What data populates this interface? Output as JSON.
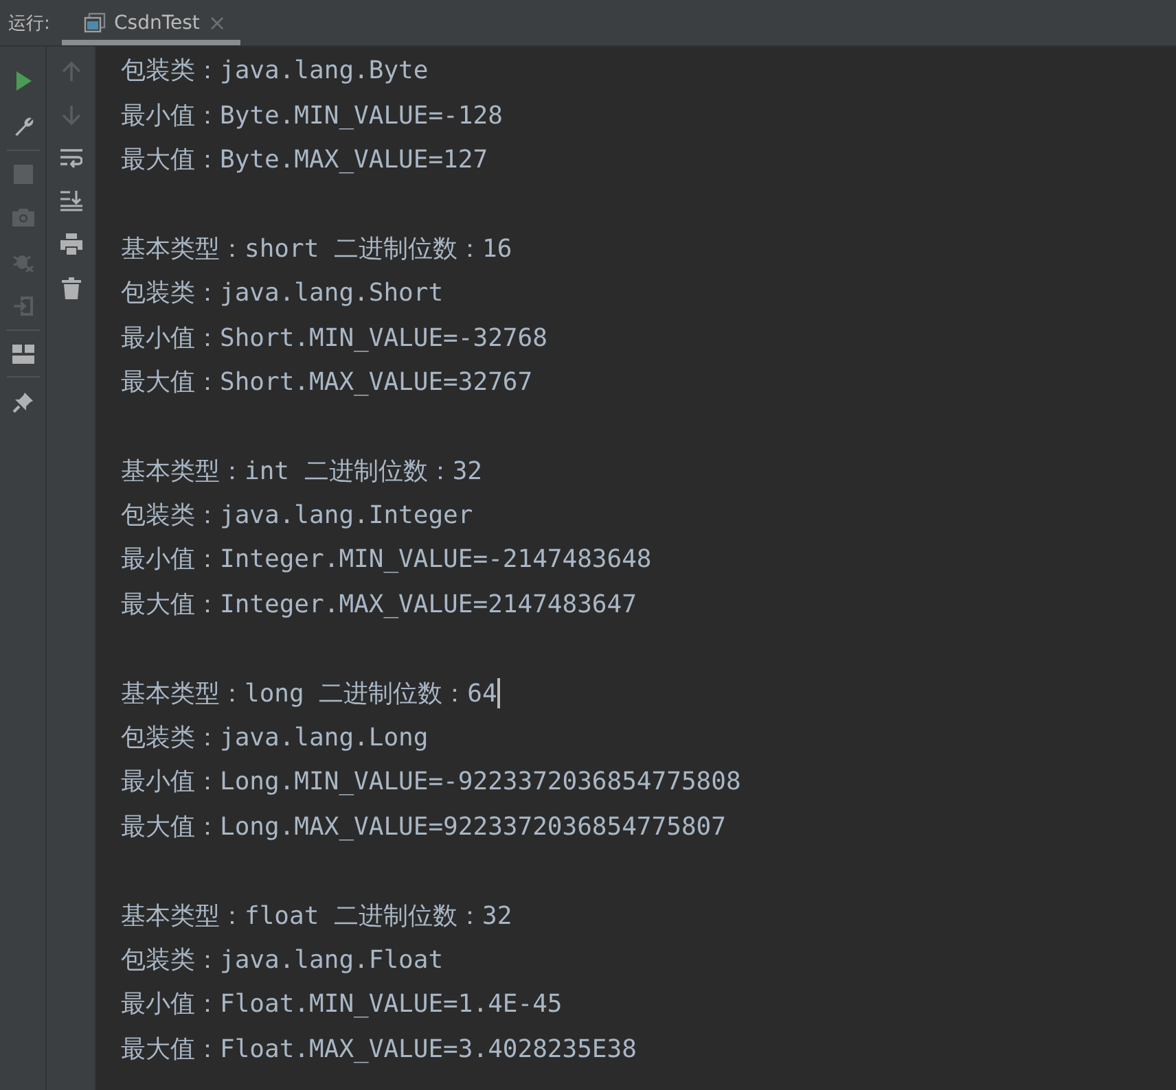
{
  "run_label": "运行:",
  "tabs": [
    {
      "label": "CsdnTest",
      "close": "×",
      "selected": true
    }
  ],
  "console": [
    [
      {
        "text": "包装类：java.lang.Byte",
        "cursor": false
      },
      {
        "text": "最小值：Byte.MIN_VALUE=-128",
        "cursor": false
      },
      {
        "text": "最大值：Byte.MAX_VALUE=127",
        "cursor": false
      }
    ],
    [
      {
        "text": "基本类型：short 二进制位数：16",
        "cursor": false
      },
      {
        "text": "包装类：java.lang.Short",
        "cursor": false
      },
      {
        "text": "最小值：Short.MIN_VALUE=-32768",
        "cursor": false
      },
      {
        "text": "最大值：Short.MAX_VALUE=32767",
        "cursor": false
      }
    ],
    [
      {
        "text": "基本类型：int 二进制位数：32",
        "cursor": false
      },
      {
        "text": "包装类：java.lang.Integer",
        "cursor": false
      },
      {
        "text": "最小值：Integer.MIN_VALUE=-2147483648",
        "cursor": false
      },
      {
        "text": "最大值：Integer.MAX_VALUE=2147483647",
        "cursor": false
      }
    ],
    [
      {
        "text": "基本类型：long 二进制位数：64",
        "cursor": true
      },
      {
        "text": "包装类：java.lang.Long",
        "cursor": false
      },
      {
        "text": "最小值：Long.MIN_VALUE=-9223372036854775808",
        "cursor": false
      },
      {
        "text": "最大值：Long.MAX_VALUE=9223372036854775807",
        "cursor": false
      }
    ],
    [
      {
        "text": "基本类型：float 二进制位数：32",
        "cursor": false
      },
      {
        "text": "包装类：java.lang.Float",
        "cursor": false
      },
      {
        "text": "最小值：Float.MIN_VALUE=1.4E-45",
        "cursor": false
      },
      {
        "text": "最大值：Float.MAX_VALUE=3.4028235E38",
        "cursor": false
      }
    ]
  ]
}
